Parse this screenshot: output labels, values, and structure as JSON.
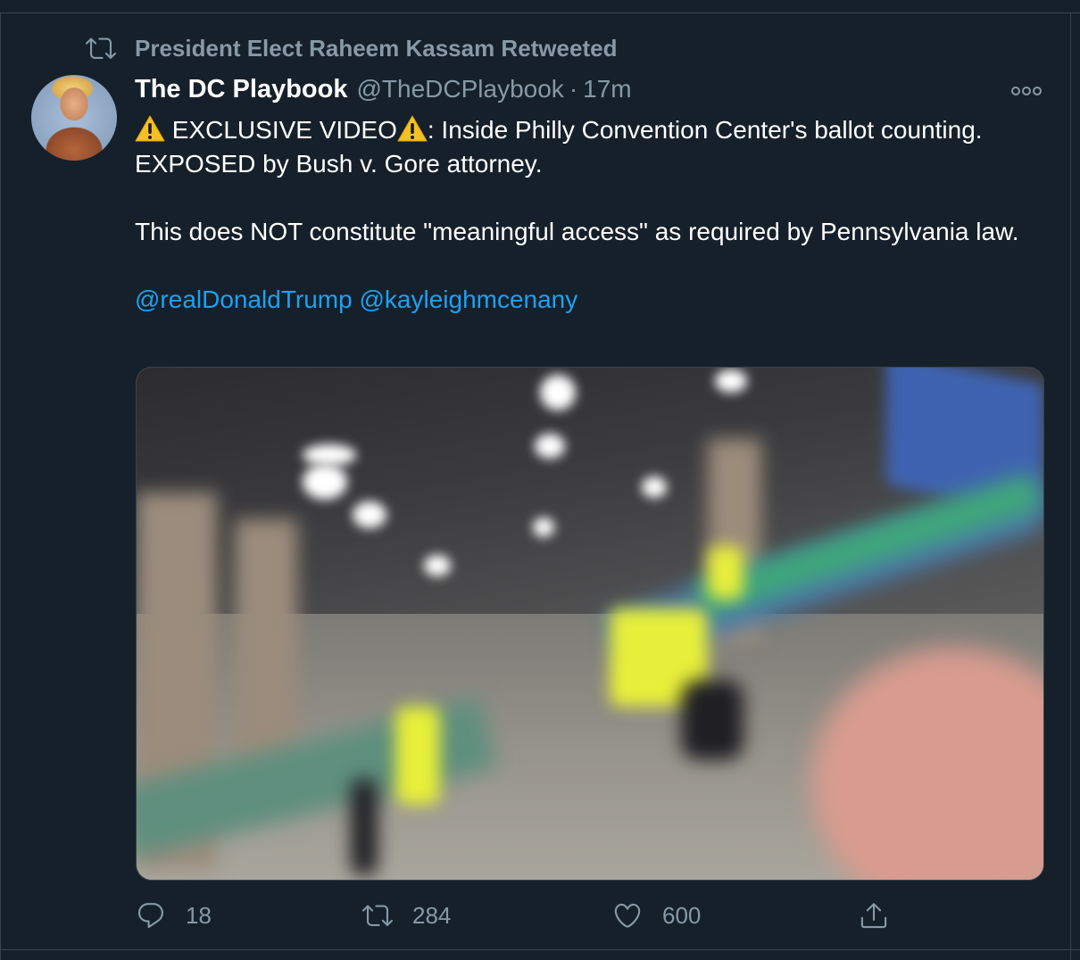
{
  "retweet_context": {
    "text": "President Elect Raheem Kassam Retweeted",
    "icon": "retweet-icon"
  },
  "tweet": {
    "display_name": "The DC Playbook",
    "handle": "@TheDCPlaybook",
    "separator": "·",
    "time": "17m",
    "text": {
      "line1_a": "EXCLUSIVE VIDEO",
      "line1_b": ": Inside Philly Convention Center's ballot counting. EXPOSED by Bush v. Gore attorney.",
      "paragraph2": "This does NOT constitute \"meaningful access\" as required by Pennsylvania law.",
      "mention1": "@realDonaldTrump",
      "mention2": "@kayleighmcenany"
    },
    "warning_icon": "warning-icon",
    "more_icon": "more-icon"
  },
  "actions": {
    "reply_count": "18",
    "retweet_count": "284",
    "like_count": "600"
  },
  "colors": {
    "background": "#15202b",
    "secondary_text": "#8899a6",
    "link": "#1da1f2",
    "border": "#38444d"
  }
}
